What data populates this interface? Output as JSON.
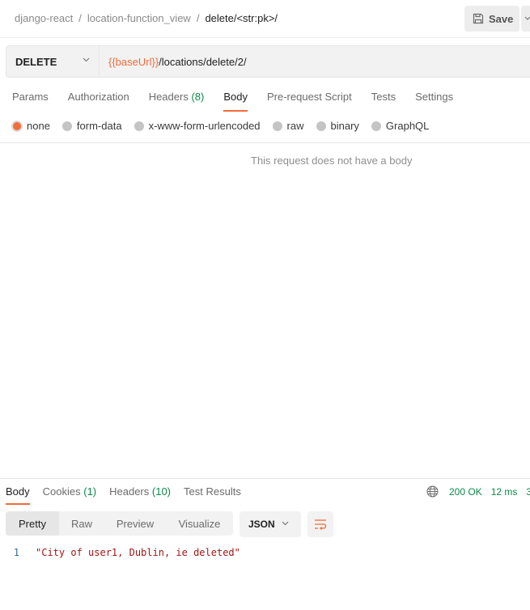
{
  "header": {
    "breadcrumb": [
      "django-react",
      "location-function_view"
    ],
    "current": "delete/<str:pk>/",
    "separator": "/",
    "save_label": "Save"
  },
  "request": {
    "method": "DELETE",
    "url_variable": "{{baseUrl}}",
    "url_path": "/locations/delete/2/",
    "tabs": [
      {
        "label": "Params",
        "count": null,
        "active": false
      },
      {
        "label": "Authorization",
        "count": null,
        "active": false
      },
      {
        "label": "Headers",
        "count": "(8)",
        "active": false
      },
      {
        "label": "Body",
        "count": null,
        "active": true
      },
      {
        "label": "Pre-request Script",
        "count": null,
        "active": false
      },
      {
        "label": "Tests",
        "count": null,
        "active": false
      },
      {
        "label": "Settings",
        "count": null,
        "active": false
      }
    ],
    "body_types": [
      {
        "label": "none",
        "checked": true
      },
      {
        "label": "form-data",
        "checked": false
      },
      {
        "label": "x-www-form-urlencoded",
        "checked": false
      },
      {
        "label": "raw",
        "checked": false
      },
      {
        "label": "binary",
        "checked": false
      },
      {
        "label": "GraphQL",
        "checked": false
      }
    ],
    "empty_message": "This request does not have a body"
  },
  "response": {
    "tabs": [
      {
        "label": "Body",
        "count": null,
        "active": true
      },
      {
        "label": "Cookies",
        "count": "(1)",
        "active": false
      },
      {
        "label": "Headers",
        "count": "(10)",
        "active": false
      },
      {
        "label": "Test Results",
        "count": null,
        "active": false
      }
    ],
    "status": "200 OK",
    "time": "12 ms",
    "size_partial": "3",
    "views": [
      "Pretty",
      "Raw",
      "Preview",
      "Visualize"
    ],
    "active_view": "Pretty",
    "format": "JSON",
    "lines": [
      {
        "no": "1",
        "text": "\"City of user1, Dublin, ie deleted\""
      }
    ]
  },
  "colors": {
    "accent": "#f26b3a",
    "status_green": "#0b8a48",
    "string_red": "#a31515"
  }
}
